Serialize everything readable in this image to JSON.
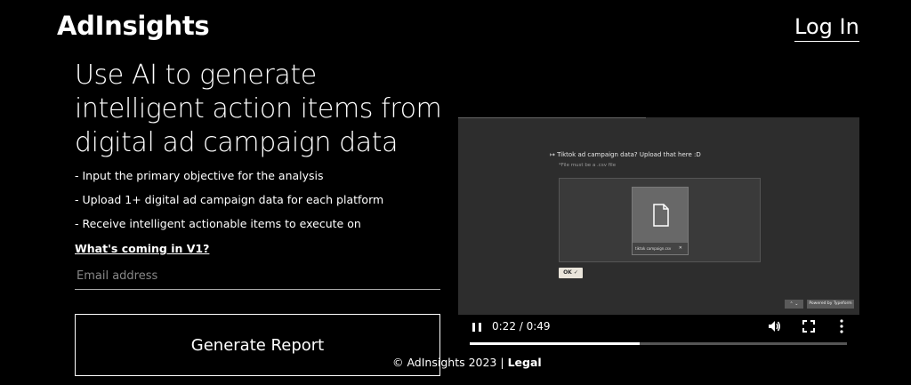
{
  "header": {
    "brand": "AdInsights",
    "login_label": "Log In"
  },
  "hero": {
    "headline": "Use AI to generate intelligent action items from digital ad campaign data",
    "bullets": [
      "- Input the primary objective for the analysis",
      "- Upload 1+ digital ad campaign data for each platform",
      "- Receive intelligent actionable items to execute on"
    ],
    "v1_link": "What's coming in V1?",
    "email_placeholder": "Email address",
    "generate_label": "Generate Report"
  },
  "video": {
    "form_prompt": "Tiktok ad campaign data? Upload that here :D",
    "form_note": "*File must be a .csv file",
    "file_name": "tiktok campaign.csv",
    "ok_label": "OK ✓",
    "typeform_badge": "Powered by Typeform",
    "time": "0:22 / 0:49",
    "progress": 0.45
  },
  "footer": {
    "copyright": "© AdInsights 2023 | ",
    "legal": "Legal"
  }
}
